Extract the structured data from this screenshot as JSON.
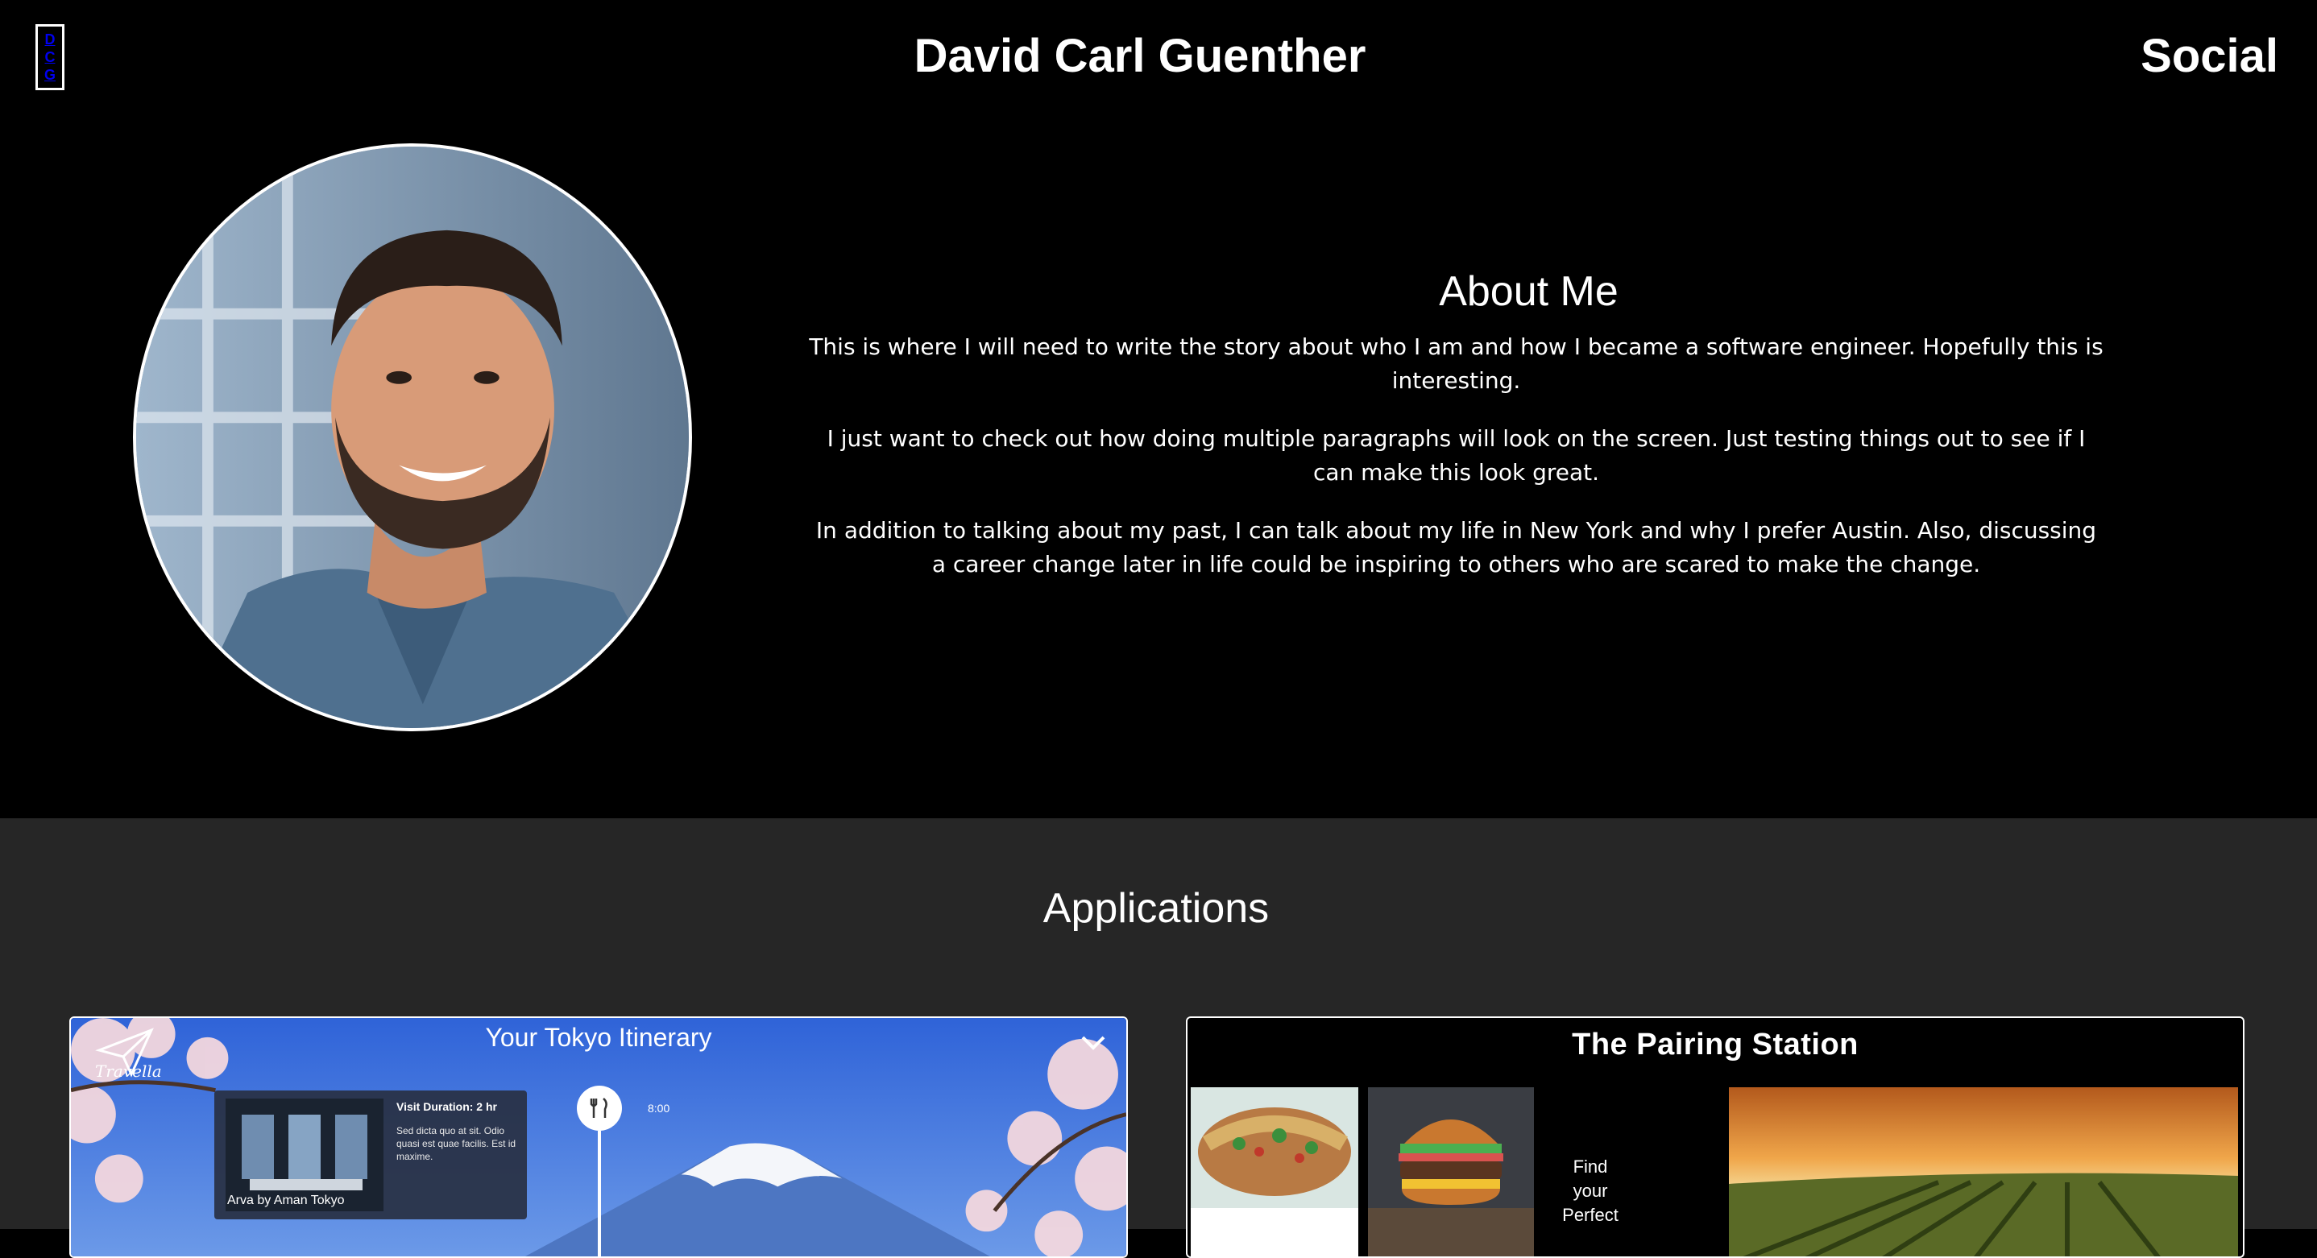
{
  "header": {
    "logo_letters": [
      "D",
      "C",
      "G"
    ],
    "title": "David Carl Guenther",
    "social_label": "Social"
  },
  "about": {
    "heading": "About Me",
    "paragraphs": [
      "This is where I will need to write the story about who I am and how I became a software engineer. Hopefully this is interesting.",
      "I just want to check out how doing multiple paragraphs will look on the screen. Just testing things out to see if I can make this look great.",
      "In addition to talking about my past, I can talk about my life in New York and why I prefer Austin. Also, discussing a career change later in life could be inspiring to others who are scared to make the change."
    ]
  },
  "applications": {
    "heading": "Applications",
    "cards": [
      {
        "title": "Your Tokyo Itinerary",
        "brand": "Travella",
        "place_label": "Arva by Aman Tokyo",
        "visit_duration": "Visit Duration: 2 hr",
        "description": "Sed dicta quo at sit. Odio quasi est quae facilis. Est id maxime.",
        "time": "8:00"
      },
      {
        "title": "The Pairing Station",
        "tagline_lines": [
          "Find",
          "your",
          "Perfect"
        ]
      }
    ]
  },
  "colors": {
    "page_bg": "#000000",
    "apps_bg": "#262626",
    "text": "#ffffff"
  },
  "icons": [
    "avatar-photo",
    "paper-plane-icon",
    "chevron-down-icon",
    "fork-knife-icon"
  ]
}
